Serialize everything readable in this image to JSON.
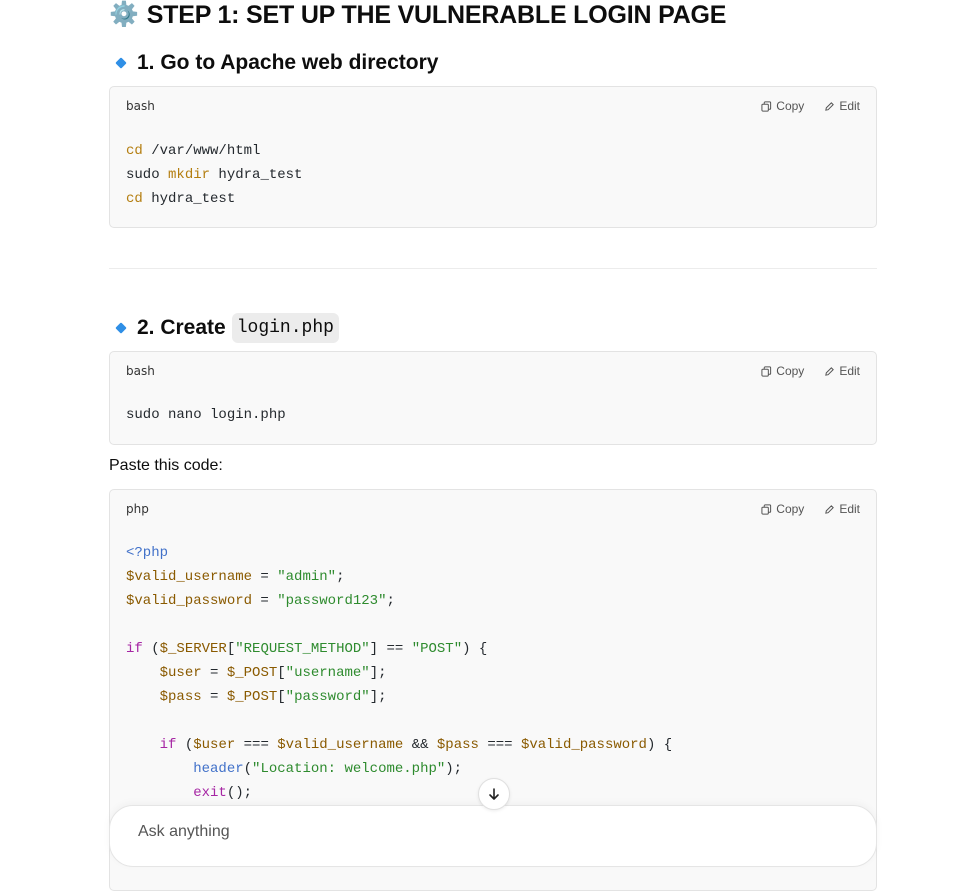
{
  "heading": {
    "icon": "gear-icon",
    "text": "STEP 1: SET UP THE VULNERABLE LOGIN PAGE"
  },
  "steps": [
    {
      "title": "1. Go to Apache web directory",
      "lang": "bash",
      "copy_label": "Copy",
      "edit_label": "Edit"
    },
    {
      "title_prefix": "2. Create",
      "title_code": "login.php",
      "lang": "bash",
      "copy_label": "Copy",
      "edit_label": "Edit"
    }
  ],
  "paste_text": "Paste this code:",
  "php_block": {
    "lang": "php",
    "copy_label": "Copy",
    "edit_label": "Edit"
  },
  "code1": [
    [
      [
        "kw",
        "cd"
      ],
      [
        "pl",
        " /var/www/html"
      ]
    ],
    [
      [
        "pl",
        "sudo "
      ],
      [
        "kw",
        "mkdir"
      ],
      [
        "pl",
        " hydra_test"
      ]
    ],
    [
      [
        "kw",
        "cd"
      ],
      [
        "pl",
        " hydra_test"
      ]
    ]
  ],
  "code2": [
    [
      [
        "pl",
        "sudo nano login.php"
      ]
    ]
  ],
  "code3": [
    [
      [
        "tag",
        "<?php"
      ]
    ],
    [
      [
        "var",
        "$valid_username"
      ],
      [
        "pl",
        " = "
      ],
      [
        "str",
        "\"admin\""
      ],
      [
        "pl",
        ";"
      ]
    ],
    [
      [
        "var",
        "$valid_password"
      ],
      [
        "pl",
        " = "
      ],
      [
        "str",
        "\"password123\""
      ],
      [
        "pl",
        ";"
      ]
    ],
    [
      [
        "pl",
        ""
      ]
    ],
    [
      [
        "purple",
        "if"
      ],
      [
        "pl",
        " ("
      ],
      [
        "var",
        "$_SERVER"
      ],
      [
        "pl",
        "["
      ],
      [
        "str",
        "\"REQUEST_METHOD\""
      ],
      [
        "pl",
        "] == "
      ],
      [
        "str",
        "\"POST\""
      ],
      [
        "pl",
        ") {"
      ]
    ],
    [
      [
        "pl",
        "    "
      ],
      [
        "var",
        "$user"
      ],
      [
        "pl",
        " = "
      ],
      [
        "var",
        "$_POST"
      ],
      [
        "pl",
        "["
      ],
      [
        "str",
        "\"username\""
      ],
      [
        "pl",
        "];"
      ]
    ],
    [
      [
        "pl",
        "    "
      ],
      [
        "var",
        "$pass"
      ],
      [
        "pl",
        " = "
      ],
      [
        "var",
        "$_POST"
      ],
      [
        "pl",
        "["
      ],
      [
        "str",
        "\"password\""
      ],
      [
        "pl",
        "];"
      ]
    ],
    [
      [
        "pl",
        ""
      ]
    ],
    [
      [
        "pl",
        "    "
      ],
      [
        "purple",
        "if"
      ],
      [
        "pl",
        " ("
      ],
      [
        "var",
        "$user"
      ],
      [
        "pl",
        " === "
      ],
      [
        "var",
        "$valid_username"
      ],
      [
        "pl",
        " && "
      ],
      [
        "var",
        "$pass"
      ],
      [
        "pl",
        " === "
      ],
      [
        "var",
        "$valid_password"
      ],
      [
        "pl",
        ") {"
      ]
    ],
    [
      [
        "pl",
        "        "
      ],
      [
        "fn",
        "header"
      ],
      [
        "pl",
        "("
      ],
      [
        "str",
        "\"Location: welcome.php\""
      ],
      [
        "pl",
        ");"
      ]
    ],
    [
      [
        "pl",
        "        "
      ],
      [
        "purple",
        "exit"
      ],
      [
        "pl",
        "();"
      ]
    ]
  ],
  "composer": {
    "placeholder": "Ask anything"
  }
}
